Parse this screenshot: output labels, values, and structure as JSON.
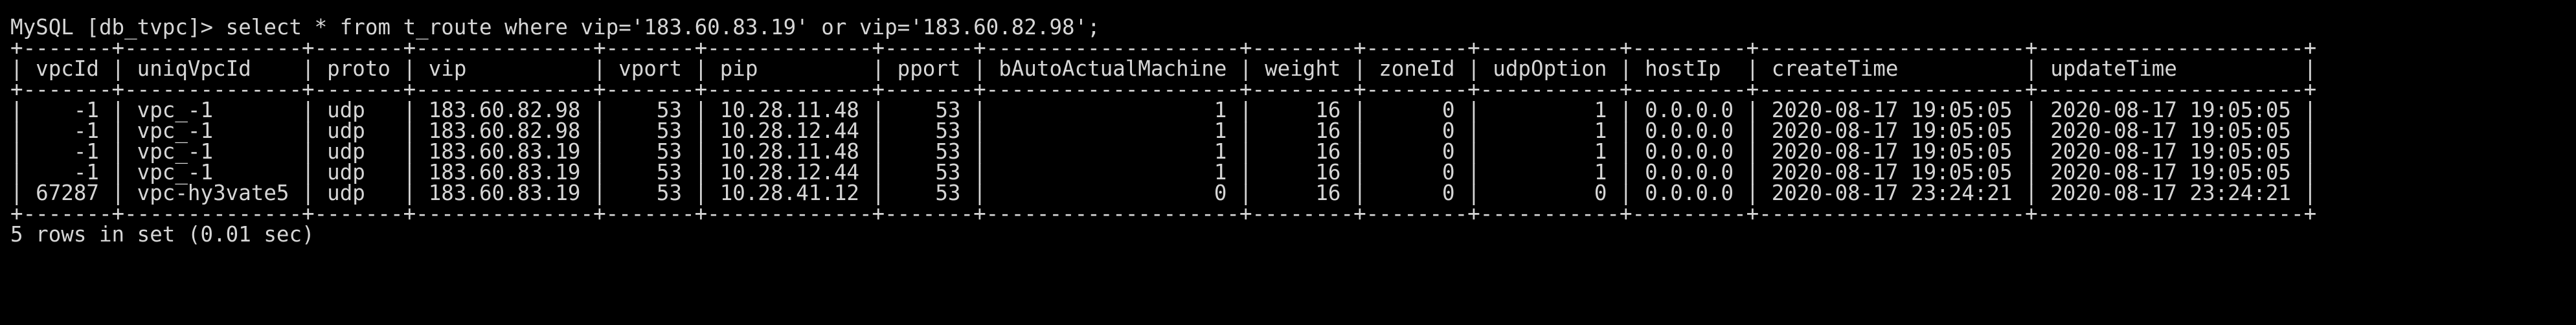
{
  "terminal": {
    "prompt": "MySQL [db_tvpc]> ",
    "command": "select * from t_route where vip='183.60.83.19' or vip='183.60.82.98';",
    "columns": [
      "vpcId",
      "uniqVpcId",
      "proto",
      "vip",
      "vport",
      "pip",
      "pport",
      "bAutoActualMachine",
      "weight",
      "zoneId",
      "udpOption",
      "hostIp",
      "createTime",
      "updateTime"
    ],
    "rows": [
      [
        "-1",
        "vpc_-1",
        "udp",
        "183.60.82.98",
        "53",
        "10.28.11.48",
        "53",
        "1",
        "16",
        "0",
        "1",
        "0.0.0.0",
        "2020-08-17 19:05:05",
        "2020-08-17 19:05:05"
      ],
      [
        "-1",
        "vpc_-1",
        "udp",
        "183.60.82.98",
        "53",
        "10.28.12.44",
        "53",
        "1",
        "16",
        "0",
        "1",
        "0.0.0.0",
        "2020-08-17 19:05:05",
        "2020-08-17 19:05:05"
      ],
      [
        "-1",
        "vpc_-1",
        "udp",
        "183.60.83.19",
        "53",
        "10.28.11.48",
        "53",
        "1",
        "16",
        "0",
        "1",
        "0.0.0.0",
        "2020-08-17 19:05:05",
        "2020-08-17 19:05:05"
      ],
      [
        "-1",
        "vpc_-1",
        "udp",
        "183.60.83.19",
        "53",
        "10.28.12.44",
        "53",
        "1",
        "16",
        "0",
        "1",
        "0.0.0.0",
        "2020-08-17 19:05:05",
        "2020-08-17 19:05:05"
      ],
      [
        "67287",
        "vpc-hy3vate5",
        "udp",
        "183.60.83.19",
        "53",
        "10.28.41.12",
        "53",
        "0",
        "16",
        "0",
        "0",
        "0.0.0.0",
        "2020-08-17 23:24:21",
        "2020-08-17 23:24:21"
      ]
    ],
    "right_aligned": [
      "vpcId",
      "vport",
      "pport",
      "bAutoActualMachine",
      "weight",
      "zoneId",
      "udpOption"
    ],
    "summary": "5 rows in set (0.01 sec)"
  }
}
